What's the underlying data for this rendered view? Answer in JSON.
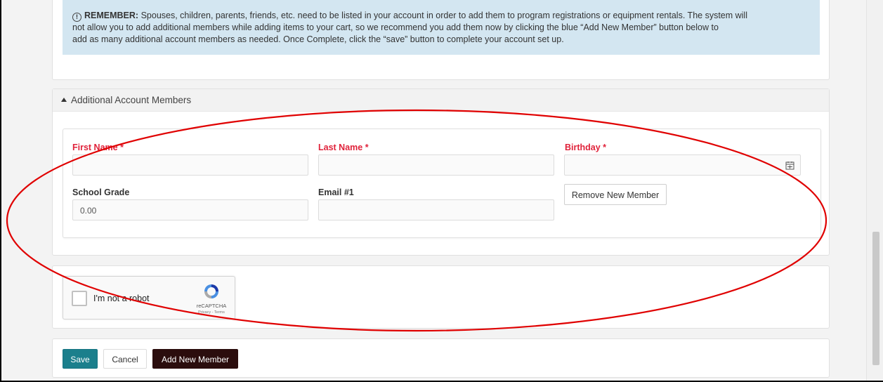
{
  "notice": {
    "icon": "info-circle-icon",
    "strong": "REMEMBER:",
    "line1": "Spouses, children, parents, friends, etc. need to be listed in your account in order to add them to program registrations or equipment rentals. The system will",
    "line2": "not allow you to add additional members while adding items to your cart, so we recommend you add them now by clicking the blue “Add New Member” button below to",
    "line3": "add as many additional account members as needed. Once Complete, click the “save” button to complete your account set up.",
    "background_color": "#d3e6f1"
  },
  "members": {
    "header": "Additional Account Members",
    "caret_icon": "caret-up-icon",
    "first_name": {
      "label": "First Name *",
      "value": ""
    },
    "last_name": {
      "label": "Last Name *",
      "value": ""
    },
    "birthday": {
      "label": "Birthday *",
      "value": "",
      "icon": "calendar-icon"
    },
    "school_grade": {
      "label": "School Grade",
      "value": "0.00"
    },
    "email": {
      "label": "Email #1",
      "value": ""
    },
    "remove_button": "Remove New Member",
    "required_color": "#e0223a"
  },
  "captcha": {
    "label": "I'm not a robot",
    "brand": "reCAPTCHA",
    "links": "Privacy - Terms"
  },
  "actions": {
    "save": "Save",
    "cancel": "Cancel",
    "add_member": "Add New Member",
    "save_color": "#1b7f8c",
    "add_color": "#2b0d0d"
  },
  "annotation": {
    "ellipse_color": "#e00000"
  }
}
